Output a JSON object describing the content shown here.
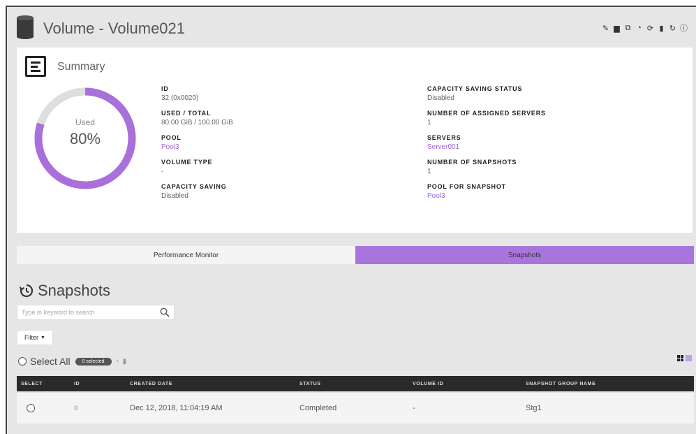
{
  "header": {
    "title": "Volume - Volume021",
    "toolbar_icons": [
      "pencil-icon",
      "document-icon",
      "export-icon",
      "snapshot-icon",
      "sync-icon",
      "trash-icon",
      "refresh-icon",
      "help-icon"
    ]
  },
  "summary": {
    "title": "Summary",
    "used_label": "Used",
    "used_percent_text": "80%",
    "used_fraction": 0.8,
    "accent_color": "#a970dc",
    "left_fields": [
      {
        "label": "ID",
        "value": "32 (0x0020)"
      },
      {
        "label": "USED / TOTAL",
        "value": "80.00 GiB / 100.00 GiB"
      },
      {
        "label": "POOL",
        "value": "Pool3"
      },
      {
        "label": "VOLUME TYPE",
        "value": "-"
      },
      {
        "label": "CAPACITY SAVING",
        "value": "Disabled"
      }
    ],
    "right_fields": [
      {
        "label": "CAPACITY SAVING STATUS",
        "value": "Disabled"
      },
      {
        "label": "NUMBER OF ASSIGNED SERVERS",
        "value": "1"
      },
      {
        "label": "SERVERS",
        "value": "Server001"
      },
      {
        "label": "NUMBER OF SNAPSHOTS",
        "value": "1"
      },
      {
        "label": "POOL FOR SNAPSHOT",
        "value": "Pool3"
      }
    ]
  },
  "tabs": [
    {
      "label": "Performance Monitor",
      "active": false
    },
    {
      "label": "Snapshots",
      "active": true
    }
  ],
  "snapshots": {
    "title": "Snapshots",
    "search_placeholder": "Type in keyword to search",
    "filter_label": "Filter",
    "select_all_label": "Select All",
    "selected_badge": "0 selected",
    "columns": [
      "SELECT",
      "ID",
      "CREATED DATE",
      "STATUS",
      "VOLUME ID",
      "SNAPSHOT GROUP NAME"
    ],
    "rows": [
      {
        "id": "0",
        "created_date": "Dec 12, 2018, 11:04:19 AM",
        "status": "Completed",
        "volume_id": "-",
        "group_name": "Stg1"
      }
    ]
  }
}
